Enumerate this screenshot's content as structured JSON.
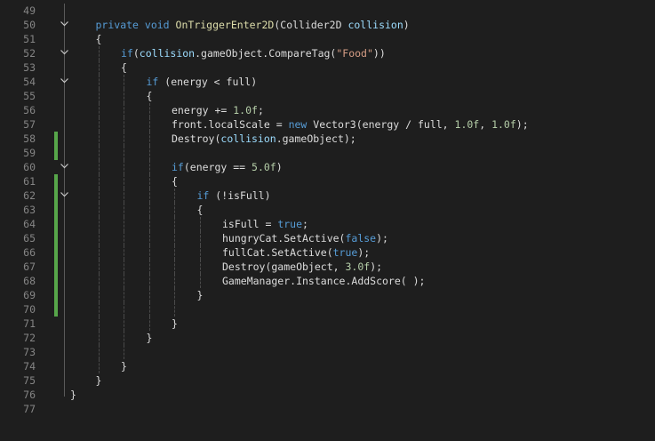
{
  "editor": {
    "lines": [
      {
        "num": "49",
        "fold": "",
        "changed": false,
        "indent": 0,
        "tokens": []
      },
      {
        "num": "50",
        "fold": "v",
        "changed": false,
        "indent": 1,
        "tokens": [
          {
            "t": "private",
            "c": "kw"
          },
          {
            "t": " ",
            "c": "pl"
          },
          {
            "t": "void",
            "c": "kw"
          },
          {
            "t": " ",
            "c": "pl"
          },
          {
            "t": "OnTriggerEnter2D",
            "c": "fn"
          },
          {
            "t": "(",
            "c": "pl"
          },
          {
            "t": "Collider2D",
            "c": "type"
          },
          {
            "t": " ",
            "c": "pl"
          },
          {
            "t": "collision",
            "c": "param"
          },
          {
            "t": ")",
            "c": "pl"
          }
        ]
      },
      {
        "num": "51",
        "fold": "",
        "changed": false,
        "indent": 1,
        "tokens": [
          {
            "t": "{",
            "c": "pl"
          }
        ]
      },
      {
        "num": "52",
        "fold": "v",
        "changed": false,
        "indent": 2,
        "tokens": [
          {
            "t": "if",
            "c": "kw"
          },
          {
            "t": "(",
            "c": "pl"
          },
          {
            "t": "collision",
            "c": "param"
          },
          {
            "t": ".gameObject.CompareTag(",
            "c": "pl"
          },
          {
            "t": "\"Food\"",
            "c": "str"
          },
          {
            "t": "))",
            "c": "pl"
          }
        ]
      },
      {
        "num": "53",
        "fold": "",
        "changed": false,
        "indent": 2,
        "tokens": [
          {
            "t": "{",
            "c": "pl"
          }
        ]
      },
      {
        "num": "54",
        "fold": "v",
        "changed": false,
        "indent": 3,
        "tokens": [
          {
            "t": "if",
            "c": "kw"
          },
          {
            "t": " (energy < full)",
            "c": "pl"
          }
        ]
      },
      {
        "num": "55",
        "fold": "",
        "changed": false,
        "indent": 3,
        "tokens": [
          {
            "t": "{",
            "c": "pl"
          }
        ]
      },
      {
        "num": "56",
        "fold": "",
        "changed": false,
        "indent": 4,
        "tokens": [
          {
            "t": "energy += ",
            "c": "pl"
          },
          {
            "t": "1.0f",
            "c": "num"
          },
          {
            "t": ";",
            "c": "pl"
          }
        ]
      },
      {
        "num": "57",
        "fold": "",
        "changed": false,
        "indent": 4,
        "tokens": [
          {
            "t": "front.localScale = ",
            "c": "pl"
          },
          {
            "t": "new",
            "c": "kw"
          },
          {
            "t": " Vector3(energy / full, ",
            "c": "pl"
          },
          {
            "t": "1.0f",
            "c": "num"
          },
          {
            "t": ", ",
            "c": "pl"
          },
          {
            "t": "1.0f",
            "c": "num"
          },
          {
            "t": ");",
            "c": "pl"
          }
        ]
      },
      {
        "num": "58",
        "fold": "",
        "changed": true,
        "indent": 4,
        "tokens": [
          {
            "t": "Destroy(",
            "c": "pl"
          },
          {
            "t": "collision",
            "c": "param"
          },
          {
            "t": ".gameObject);",
            "c": "pl"
          }
        ]
      },
      {
        "num": "59",
        "fold": "",
        "changed": true,
        "indent": 4,
        "tokens": []
      },
      {
        "num": "60",
        "fold": "v",
        "changed": false,
        "indent": 4,
        "tokens": [
          {
            "t": "if",
            "c": "kw"
          },
          {
            "t": "(energy == ",
            "c": "pl"
          },
          {
            "t": "5.0f",
            "c": "num"
          },
          {
            "t": ")",
            "c": "pl"
          }
        ]
      },
      {
        "num": "61",
        "fold": "",
        "changed": true,
        "indent": 4,
        "tokens": [
          {
            "t": "{",
            "c": "pl"
          }
        ]
      },
      {
        "num": "62",
        "fold": "v",
        "changed": true,
        "indent": 5,
        "tokens": [
          {
            "t": "if",
            "c": "kw"
          },
          {
            "t": " (!isFull)",
            "c": "pl"
          }
        ]
      },
      {
        "num": "63",
        "fold": "",
        "changed": true,
        "indent": 5,
        "tokens": [
          {
            "t": "{",
            "c": "pl"
          }
        ]
      },
      {
        "num": "64",
        "fold": "",
        "changed": true,
        "indent": 6,
        "tokens": [
          {
            "t": "isFull = ",
            "c": "pl"
          },
          {
            "t": "true",
            "c": "kw"
          },
          {
            "t": ";",
            "c": "pl"
          }
        ]
      },
      {
        "num": "65",
        "fold": "",
        "changed": true,
        "indent": 6,
        "tokens": [
          {
            "t": "hungryCat.SetActive(",
            "c": "pl"
          },
          {
            "t": "false",
            "c": "kw"
          },
          {
            "t": ");",
            "c": "pl"
          }
        ]
      },
      {
        "num": "66",
        "fold": "",
        "changed": true,
        "indent": 6,
        "tokens": [
          {
            "t": "fullCat.SetActive(",
            "c": "pl"
          },
          {
            "t": "true",
            "c": "kw"
          },
          {
            "t": ");",
            "c": "pl"
          }
        ]
      },
      {
        "num": "67",
        "fold": "",
        "changed": true,
        "indent": 6,
        "tokens": [
          {
            "t": "Destroy(gameObject, ",
            "c": "pl"
          },
          {
            "t": "3.0f",
            "c": "num"
          },
          {
            "t": ");",
            "c": "pl"
          }
        ]
      },
      {
        "num": "68",
        "fold": "",
        "changed": true,
        "indent": 6,
        "tokens": [
          {
            "t": "GameManager.Instance.AddScore( );",
            "c": "pl"
          }
        ]
      },
      {
        "num": "69",
        "fold": "",
        "changed": true,
        "indent": 5,
        "tokens": [
          {
            "t": "}",
            "c": "pl"
          }
        ]
      },
      {
        "num": "70",
        "fold": "",
        "changed": true,
        "indent": 5,
        "tokens": []
      },
      {
        "num": "71",
        "fold": "",
        "changed": false,
        "indent": 4,
        "tokens": [
          {
            "t": "}",
            "c": "pl"
          }
        ]
      },
      {
        "num": "72",
        "fold": "",
        "changed": false,
        "indent": 3,
        "tokens": [
          {
            "t": "}",
            "c": "pl"
          }
        ]
      },
      {
        "num": "73",
        "fold": "",
        "changed": false,
        "indent": 3,
        "tokens": []
      },
      {
        "num": "74",
        "fold": "",
        "changed": false,
        "indent": 2,
        "tokens": [
          {
            "t": "}",
            "c": "pl"
          }
        ]
      },
      {
        "num": "75",
        "fold": "",
        "changed": false,
        "indent": 1,
        "tokens": [
          {
            "t": "}",
            "c": "pl"
          }
        ]
      },
      {
        "num": "76",
        "fold": "",
        "changed": false,
        "indent": 0,
        "tokens": [
          {
            "t": "}",
            "c": "pl"
          }
        ]
      },
      {
        "num": "77",
        "fold": "",
        "changed": false,
        "indent": 0,
        "tokens": []
      }
    ]
  },
  "colors": {
    "background": "#1e1e1e",
    "line_number": "#858585",
    "change_bar": "#57a64a",
    "keyword": "#569cd6",
    "method": "#dcdcaa",
    "parameter": "#9cdcfe",
    "string": "#d69d85",
    "number": "#b5cea8",
    "plain": "#dcdcdc"
  }
}
